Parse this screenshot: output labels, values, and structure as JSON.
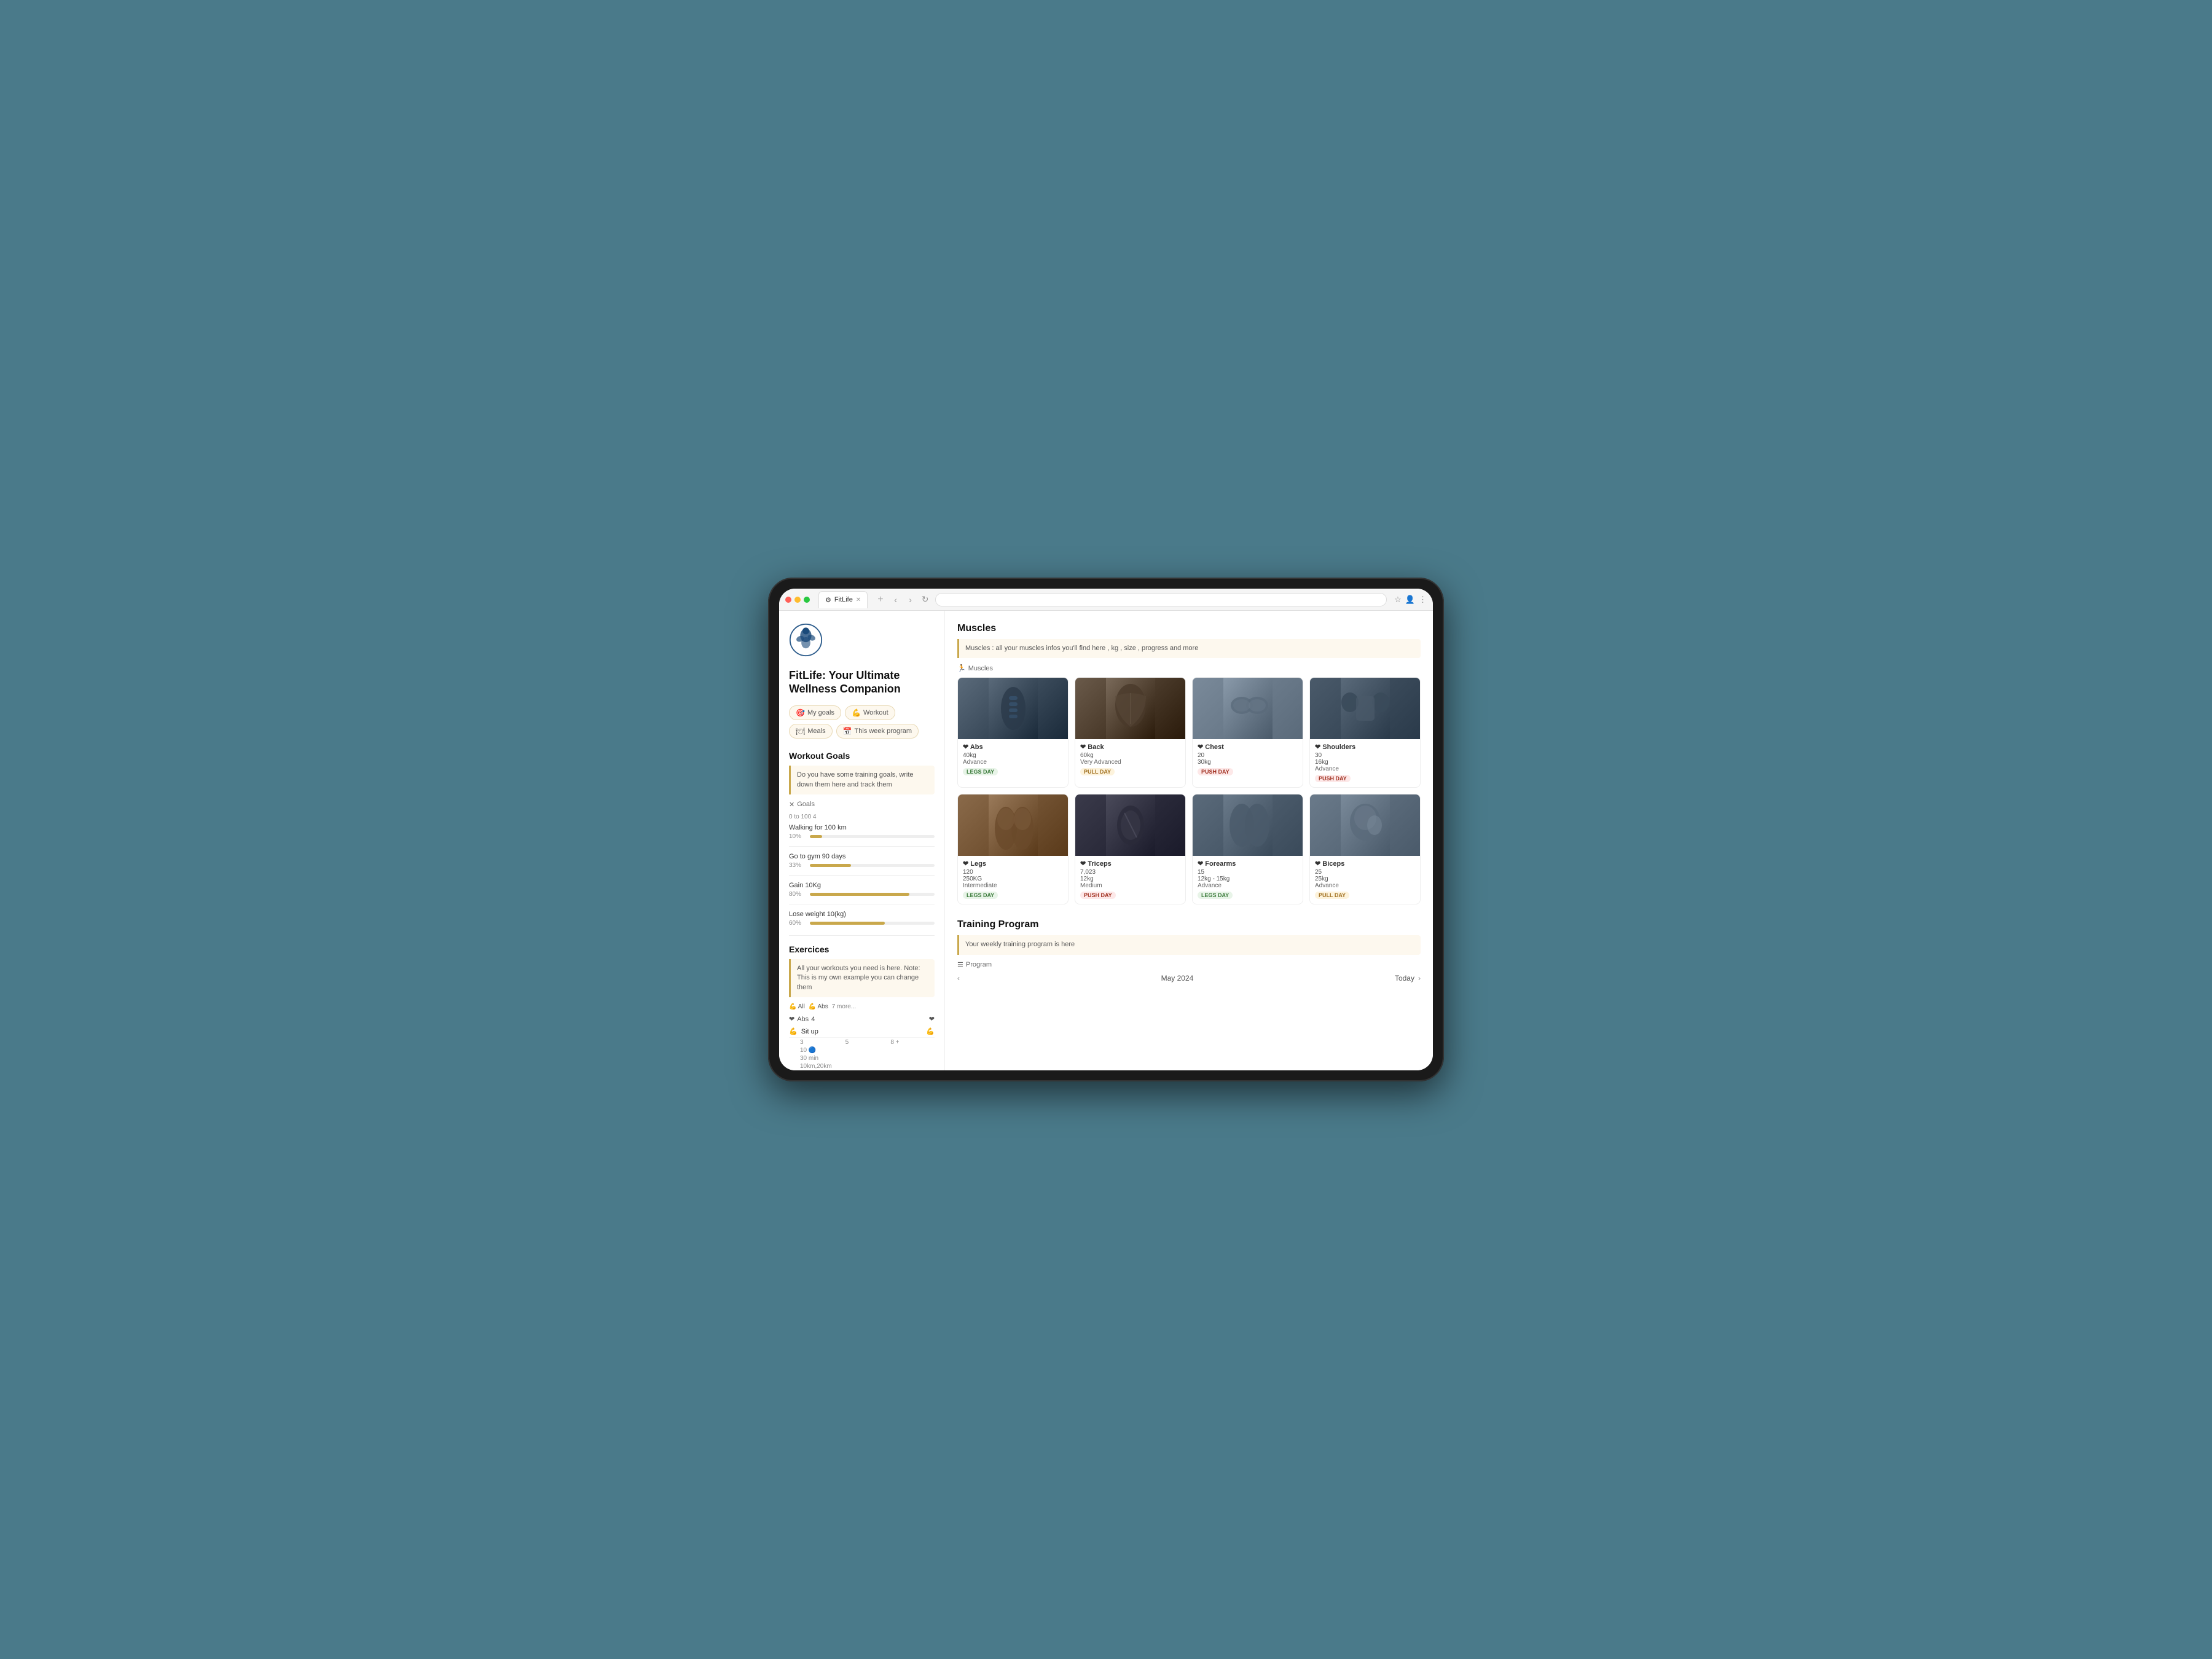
{
  "browser": {
    "tab_label": "FitLife",
    "tab_icon": "⚙",
    "nav_back": "‹",
    "nav_forward": "›",
    "nav_refresh": "↻",
    "address": "",
    "bookmark_icon": "☆",
    "user_icon": "👤",
    "more_icon": "⋮"
  },
  "app": {
    "title": "FitLife: Your Ultimate Wellness Companion",
    "logo_label": "FitLife Logo"
  },
  "nav": {
    "tabs": [
      {
        "id": "my-goals",
        "icon": "🎯",
        "label": "My goals"
      },
      {
        "id": "workout",
        "icon": "💪",
        "label": "Workout"
      },
      {
        "id": "meals",
        "icon": "🍽",
        "label": "Meals"
      },
      {
        "id": "this-week-program",
        "icon": "📅",
        "label": "This week program"
      }
    ]
  },
  "sidebar": {
    "workout_goals_title": "Workout Goals",
    "workout_goals_info": "Do  you have some training goals, write down them here and track them",
    "goals_label": "Goals",
    "goals_range": "0 to 100  4",
    "goals": [
      {
        "name": "Walking for 100 km",
        "pct": 10,
        "color": "#c9a84c"
      },
      {
        "name": "Go to gym 90 days",
        "pct": 33,
        "color": "#c9a84c"
      },
      {
        "name": "Gain 10Kg",
        "pct": 80,
        "color": "#c9a84c"
      },
      {
        "name": "Lose weight 10(kg)",
        "pct": 60,
        "color": "#c9a84c"
      }
    ],
    "exercises_title": "Exercices",
    "exercises_info": "All  your workouts you need is here. Note: This is my own example you can change them",
    "filter_tabs": [
      {
        "icon": "💪",
        "label": "All"
      },
      {
        "icon": "💪",
        "label": "Abs"
      },
      {
        "label": "7 more..."
      }
    ],
    "exercise_group": "Abs",
    "exercise_group_count": "4",
    "exercises": [
      {
        "name": "Sit up",
        "sets": "3",
        "reps": "10",
        "duration": "30 min",
        "distance": "10km,20km"
      }
    ],
    "ex_icon_label": "💪"
  },
  "muscles": {
    "section_title": "Muscles",
    "info_text": "Muscles : all your muscles infos you'll find here , kg , size , progress and more",
    "muscles_label": "Muscles",
    "items": [
      {
        "id": "abs",
        "name": "Abs",
        "weight": "40kg",
        "level": "Advance",
        "tag": "LEGS DAY",
        "tag_class": "tag-legs",
        "bg_class": "muscle-abs"
      },
      {
        "id": "back",
        "name": "Back",
        "weight": "60kg",
        "level": "Very Advanced",
        "tag": "PULL DAY",
        "tag_class": "tag-pull",
        "bg_class": "muscle-back"
      },
      {
        "id": "chest",
        "name": "Chest",
        "weight": "20",
        "weight2": "30kg",
        "level": "",
        "tag": "PUSH DAY",
        "tag_class": "tag-push",
        "bg_class": "muscle-chest"
      },
      {
        "id": "shoulders",
        "name": "Shoulders",
        "weight": "30",
        "weight2": "16kg",
        "level": "Advance",
        "tag": "PUSH DAY",
        "tag_class": "tag-push",
        "bg_class": "muscle-shoulders"
      },
      {
        "id": "legs",
        "name": "Legs",
        "weight": "120",
        "weight2": "250KG",
        "level": "Intermediate",
        "tag": "LEGS DAY",
        "tag_class": "tag-legs",
        "bg_class": "muscle-legs"
      },
      {
        "id": "triceps",
        "name": "Triceps",
        "weight": "7,023",
        "weight2": "12kg",
        "level": "Medium",
        "tag": "PUSH DAY",
        "tag_class": "tag-push",
        "bg_class": "muscle-triceps"
      },
      {
        "id": "forearms",
        "name": "Forearms",
        "weight": "15",
        "weight2": "12kg - 15kg",
        "level": "Advance",
        "tag": "LEGS DAY",
        "tag_class": "tag-legs",
        "bg_class": "muscle-forearms"
      },
      {
        "id": "biceps",
        "name": "Biceps",
        "weight": "25",
        "weight2": "25kg",
        "level": "Advance",
        "tag": "PULL DAY",
        "tag_class": "tag-pull",
        "bg_class": "muscle-biceps"
      }
    ]
  },
  "training": {
    "section_title": "Training Program",
    "info_text": "Your weekly training program is here",
    "program_label": "Program",
    "calendar_month": "May 2024",
    "today_label": "Today",
    "nav_prev": "‹",
    "nav_next": "›"
  }
}
